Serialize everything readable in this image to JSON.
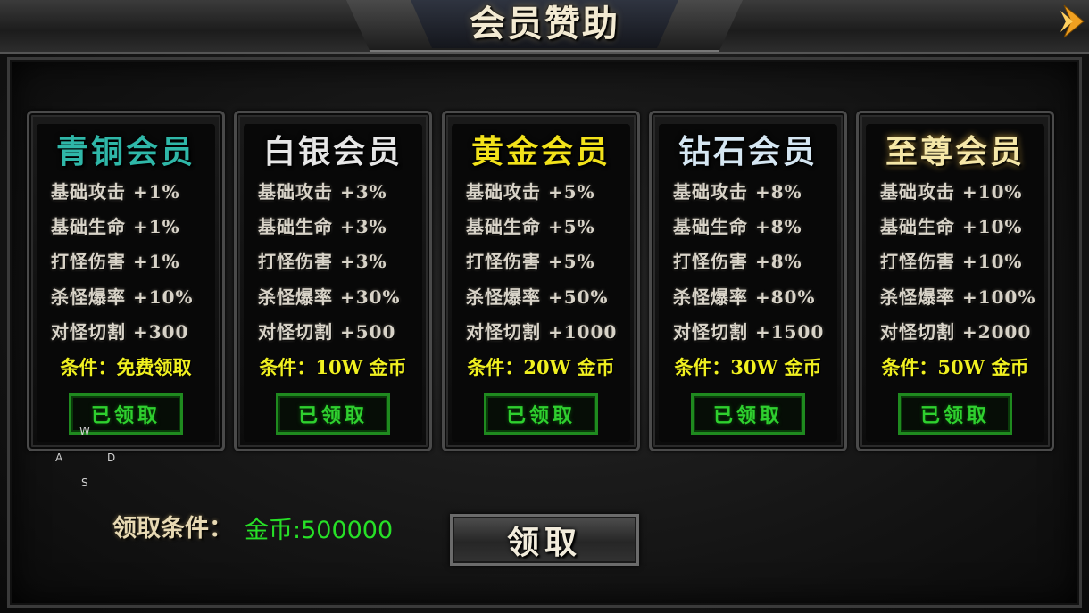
{
  "header": {
    "title": "会员赞助"
  },
  "tiers": [
    {
      "name": "青铜会员",
      "name_color": "#2fb7a8",
      "stats": [
        "基础攻击 +1%",
        "基础生命 +1%",
        "打怪伤害 +1%",
        "杀怪爆率 +10%",
        "对怪切割 +300"
      ],
      "condition": "条件：免费领取",
      "button_label": "已领取"
    },
    {
      "name": "白银会员",
      "name_color": "#e6e6e6",
      "stats": [
        "基础攻击 +3%",
        "基础生命 +3%",
        "打怪伤害 +3%",
        "杀怪爆率 +30%",
        "对怪切割 +500"
      ],
      "condition": "条件：10W 金币",
      "button_label": "已领取"
    },
    {
      "name": "黄金会员",
      "name_color": "#f2e21a",
      "stats": [
        "基础攻击 +5%",
        "基础生命 +5%",
        "打怪伤害 +5%",
        "杀怪爆率 +50%",
        "对怪切割 +1000"
      ],
      "condition": "条件：20W 金币",
      "button_label": "已领取"
    },
    {
      "name": "钻石会员",
      "name_color": "#d5e6f2",
      "stats": [
        "基础攻击 +8%",
        "基础生命 +8%",
        "打怪伤害 +8%",
        "杀怪爆率 +80%",
        "对怪切割 +1500"
      ],
      "condition": "条件：30W 金币",
      "button_label": "已领取"
    },
    {
      "name": "至尊会员",
      "name_color": "#f5e7a8",
      "stats": [
        "基础攻击 +10%",
        "基础生命 +10%",
        "打怪伤害 +10%",
        "杀怪爆率 +100%",
        "对怪切割 +2000"
      ],
      "condition": "条件：50W 金币",
      "button_label": "已领取"
    }
  ],
  "dpad": {
    "up": "W",
    "left": "A",
    "right": "D",
    "down": "S"
  },
  "footer": {
    "requirement_label": "领取条件：",
    "requirement_value": "金币:500000",
    "claim_button": "领取"
  },
  "icons": {
    "next": "chevron-right-icon"
  },
  "colors": {
    "accent_gold": "#f0b020",
    "claimed_green": "#2fd02f",
    "condition_yellow": "#f0f020"
  }
}
